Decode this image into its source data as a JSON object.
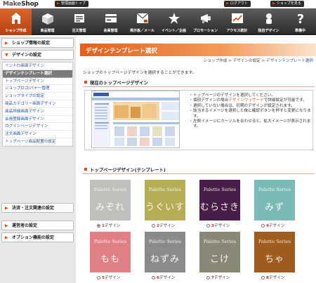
{
  "header": {
    "logo_make": "Make",
    "logo_shop": "Shop",
    "admin_top": "管理画面トップ",
    "logout": "ログアウト",
    "view_shop": "ショップを見る"
  },
  "nav": [
    {
      "label": "ショップ作成",
      "icon": "shop-icon",
      "active": true
    },
    {
      "label": "商品管理",
      "icon": "box-icon",
      "active": false
    },
    {
      "label": "注文管理",
      "icon": "cart-icon",
      "active": false
    },
    {
      "label": "会員管理",
      "icon": "member-card-icon",
      "active": false
    },
    {
      "label": "掲示板／メール",
      "icon": "mail-board-icon",
      "active": false
    },
    {
      "label": "イベント／企画",
      "icon": "event-icon",
      "active": false
    },
    {
      "label": "プロモーション",
      "icon": "promotion-icon",
      "active": false
    },
    {
      "label": "アクセス統計",
      "icon": "stats-icon",
      "active": false
    },
    {
      "label": "独自デザイン",
      "icon": "design-icon",
      "active": false
    },
    {
      "label": "準備中",
      "icon": "question-icon",
      "active": false
    }
  ],
  "sidebar": {
    "shop_info": "ショップ情報の設定",
    "design": "デザインの設定",
    "design_items": [
      "イントロ画面デザイン",
      "デザインテンプレート選択",
      "トップページデザイン",
      "ショップロゴ/バナー管理",
      "ショップタイプの設定",
      "商品カテゴリー画面デザイン",
      "商品詳細画面デザイン",
      "会員登録画面デザイン",
      "ログインページデザイン",
      "注文画面デザイン",
      "トップページ商品配置の設定"
    ],
    "active_index": 1,
    "payment": "決済・注文関連の設定",
    "operator": "運営者の設定",
    "options": "オプション機能の設定"
  },
  "main": {
    "title": "デザインテンプレート選択",
    "breadcrumb": {
      "shop": "ショップ作成",
      "sep1": ">",
      "design": "デザインの設定",
      "sep2": ">",
      "current": "デザインテンプレート選択"
    },
    "description": "ショップのトップページデザインを選択することができます。",
    "current_section": "現在のトップページデザイン",
    "notes": [
      {
        "pre": "トップページのデザインを選択してください。",
        "link": "",
        "post": ""
      },
      {
        "pre": "個別デザインの場合",
        "link": "デザインウィザード",
        "post": "で詳細設定が可能です。"
      },
      {
        "pre": "選択していない場合は、初期のデザインが設定されます。",
        "link": "",
        "post": ""
      },
      {
        "pre": "該当するイメージを選択した後に確認ボタンを押すと変更になります。",
        "link": "",
        "post": ""
      },
      {
        "pre": "左側イメージにカーソルを合わせると、拡大イメージが表示されます。",
        "link": "",
        "post": ""
      }
    ],
    "template_section": "トップページデザイン(テンプレート)",
    "brand_text": "Palette Series",
    "design_suffix": "デザイン",
    "palettes": [
      {
        "name": "みぞれ",
        "num": "1",
        "color": "#bfbfbb",
        "selected": true
      },
      {
        "name": "うぐいす",
        "num": "2",
        "color": "#b6ae54",
        "selected": false
      },
      {
        "name": "むらさき",
        "num": "3",
        "color": "#4a1c48",
        "selected": false
      },
      {
        "name": "みず",
        "num": "4",
        "color": "#7bbab6",
        "selected": false
      },
      {
        "name": "もも",
        "num": "5",
        "color": "#e08084",
        "selected": false
      },
      {
        "name": "ねずみ",
        "num": "6",
        "color": "#8a8a8a",
        "selected": false
      },
      {
        "name": "こけ",
        "num": "7",
        "color": "#888874",
        "selected": false
      },
      {
        "name": "ちゃ",
        "num": "8",
        "color": "#a05c1e",
        "selected": false
      }
    ]
  }
}
